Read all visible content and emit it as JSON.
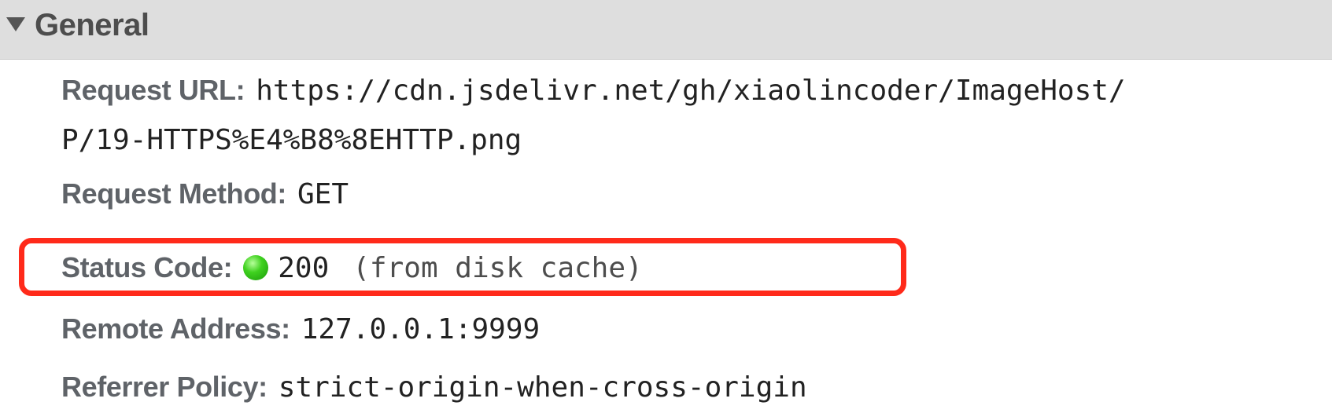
{
  "section": {
    "title": "General"
  },
  "fields": {
    "request_url": {
      "label": "Request URL:",
      "value_line1": "https://cdn.jsdelivr.net/gh/xiaolincoder/ImageHost/",
      "value_line2": "P/19-HTTPS%E4%B8%8EHTTP.png"
    },
    "request_method": {
      "label": "Request Method:",
      "value": "GET"
    },
    "status_code": {
      "label": "Status Code:",
      "value": "200",
      "note": "(from disk cache)",
      "indicator_color": "#3fd11f"
    },
    "remote_address": {
      "label": "Remote Address:",
      "value": "127.0.0.1:9999"
    },
    "referrer_policy": {
      "label": "Referrer Policy:",
      "value": "strict-origin-when-cross-origin"
    }
  },
  "annotation": {
    "highlight_color": "#ff2a1a"
  }
}
